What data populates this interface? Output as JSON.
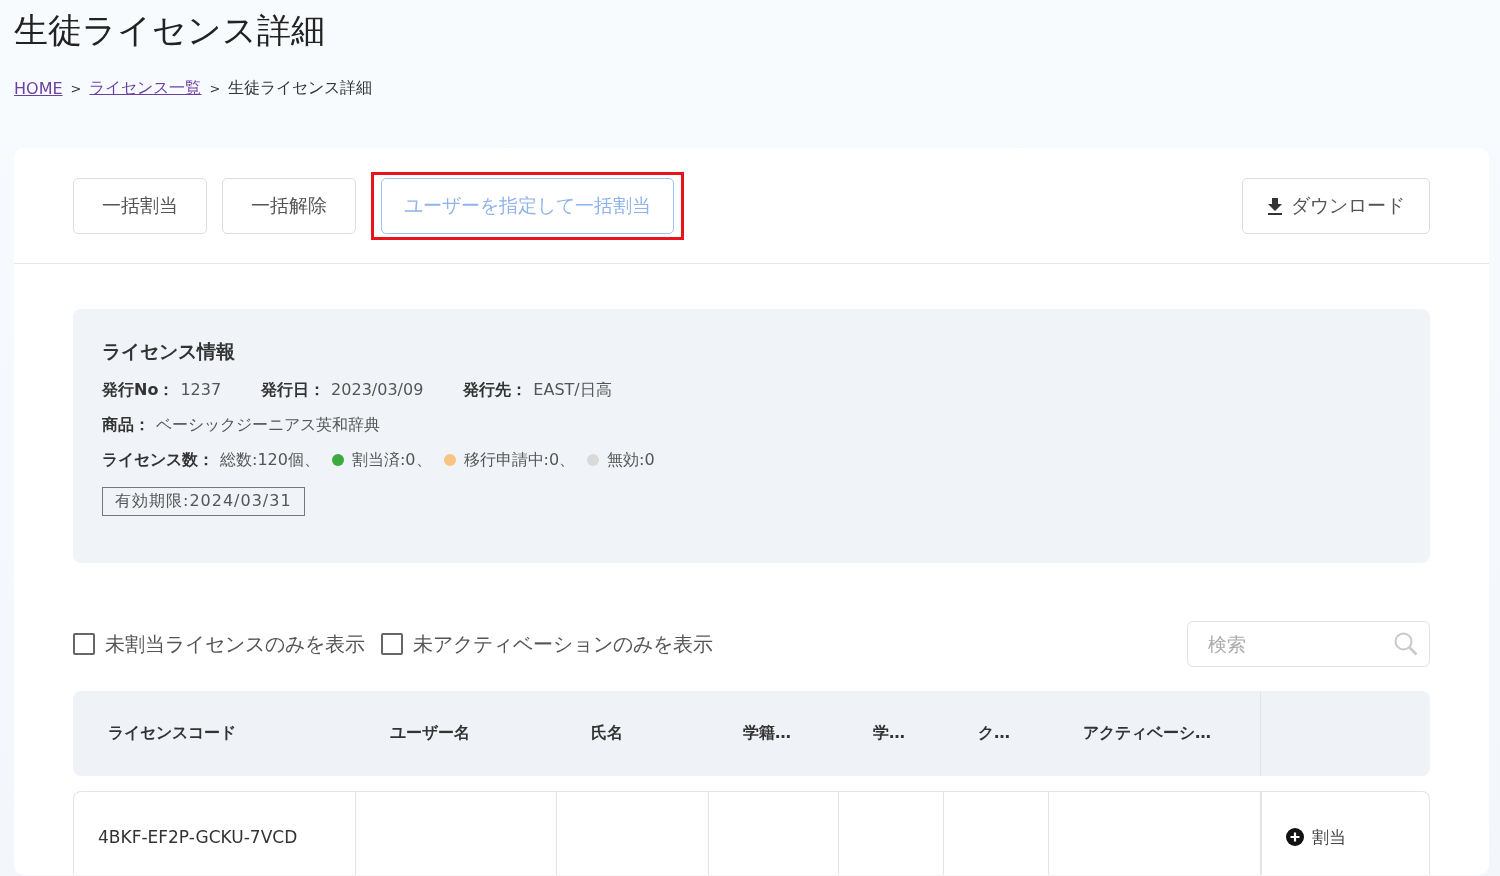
{
  "page_title": "生徒ライセンス詳細",
  "breadcrumb": [
    {
      "label": "HOME",
      "link": true
    },
    {
      "label": "ライセンス一覧",
      "link": true
    },
    {
      "label": "生徒ライセンス詳細",
      "link": false
    }
  ],
  "breadcrumb_separator": ">",
  "toolbar": {
    "buttons": [
      {
        "label": "一括割当",
        "highlighted": false
      },
      {
        "label": "一括解除",
        "highlighted": false
      },
      {
        "label": "ユーザーを指定して一括割当",
        "highlighted": true
      }
    ],
    "download": {
      "label": "ダウンロード"
    }
  },
  "license_info": {
    "title": "ライセンス情報",
    "fields": [
      {
        "label": "発行No：",
        "value": "1237"
      },
      {
        "label": "発行日：",
        "value": "2023/03/09"
      },
      {
        "label": "発行先：",
        "value": "EAST/日高"
      }
    ],
    "product": {
      "label": "商品：",
      "value": "ベーシックジーニアス英和辞典"
    },
    "count": {
      "label": "ライセンス数：",
      "total": "総数:120個、",
      "statuses": [
        {
          "text": "割当済:0、",
          "color": "#3daa3d"
        },
        {
          "text": "移行申請中:0、",
          "color": "#f9c383"
        },
        {
          "text": "無効:0",
          "color": "#d9d9d9"
        }
      ]
    },
    "expiry": "有効期限:2024/03/31"
  },
  "filters": [
    {
      "label": "未割当ライセンスのみを表示",
      "checked": false
    },
    {
      "label": "未アクティベーションのみを表示",
      "checked": false
    }
  ],
  "search": {
    "placeholder": "検索"
  },
  "table": {
    "columns": [
      "ライセンスコード",
      "ユーザー名",
      "氏名",
      "学籍…",
      "学…",
      "ク…",
      "アクティベーシ…"
    ],
    "rows": [
      {
        "cells": [
          "4BKF-EF2P-GCKU-7VCD",
          "",
          "",
          "",
          "",
          "",
          ""
        ],
        "action": "割当"
      }
    ]
  }
}
